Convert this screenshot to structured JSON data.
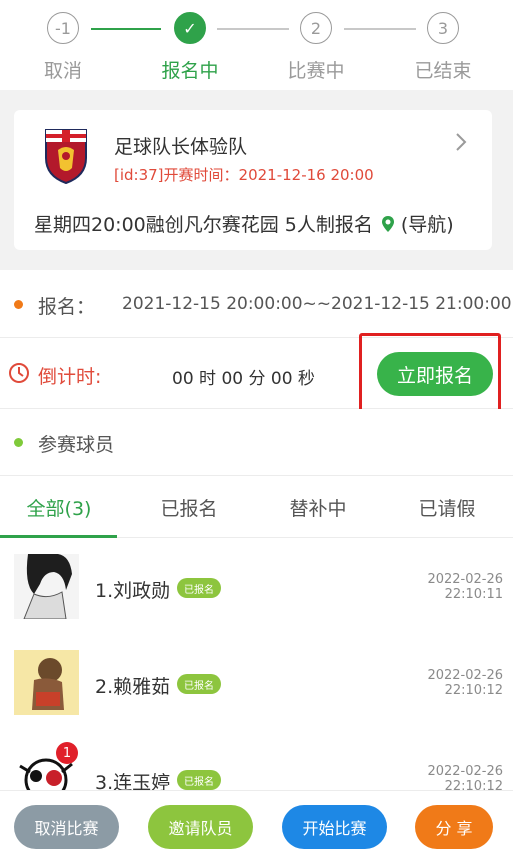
{
  "steps": [
    {
      "num": "-1",
      "label": "取消"
    },
    {
      "num": "✓",
      "label": "报名中"
    },
    {
      "num": "2",
      "label": "比赛中"
    },
    {
      "num": "3",
      "label": "已结束"
    }
  ],
  "team": {
    "name": "足球队长体验队",
    "match_time": "[id:37]开赛时间：2021-12-16 20:00",
    "venue": "星期四20:00融创凡尔赛花园 5人制报名",
    "nav_label": "(导航)"
  },
  "signup": {
    "label": "报名：",
    "value": "2021-12-15 20:00:00~~2021-12-15 21:00:00"
  },
  "countdown": {
    "label": "倒计时:",
    "value": "00 时 00 分 00 秒",
    "button": "立即报名"
  },
  "players_section": {
    "label": "参赛球员"
  },
  "tabs": [
    {
      "label": "全部(3)"
    },
    {
      "label": "已报名"
    },
    {
      "label": "替补中"
    },
    {
      "label": "已请假"
    }
  ],
  "players": [
    {
      "name": "1.刘政勋",
      "status": "已报名",
      "date": "2022-02-26",
      "time": "22:10:11"
    },
    {
      "name": "2.赖雅茹",
      "status": "已报名",
      "date": "2022-02-26",
      "time": "22:10:12"
    },
    {
      "name": "3.连玉婷",
      "status": "已报名",
      "date": "2022-02-26",
      "time": "22:10:12",
      "notification": "1"
    }
  ],
  "footer": {
    "cancel": "取消比赛",
    "invite": "邀请队员",
    "start": "开始比赛",
    "share": "分 享"
  },
  "colors": {
    "accent": "#2fa24a",
    "alert": "#e04a3a",
    "orange": "#f07a18",
    "blue": "#1e88e5"
  }
}
